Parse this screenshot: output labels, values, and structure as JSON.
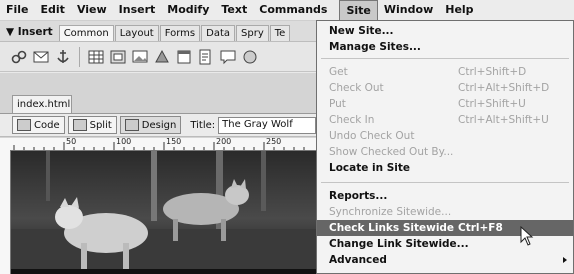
{
  "menubar": {
    "items": [
      "File",
      "Edit",
      "View",
      "Insert",
      "Modify",
      "Text",
      "Commands",
      "Site",
      "Window",
      "Help"
    ],
    "active": "Site"
  },
  "insert_bar": {
    "label": "▼ Insert",
    "tabs": [
      "Common",
      "Layout",
      "Forms",
      "Data",
      "Spry",
      "Te"
    ],
    "active_tab": "Common"
  },
  "document": {
    "tab": "index.html",
    "code_label": "Code",
    "split_label": "Split",
    "design_label": "Design",
    "title_label": "Title:",
    "title_value": "The Gray Wolf",
    "ruler_labels": [
      "50",
      "100",
      "150",
      "200",
      "250"
    ]
  },
  "site_menu": {
    "items": [
      {
        "label": "New Site...",
        "shortcut": "",
        "state": "bold"
      },
      {
        "label": "Manage Sites...",
        "shortcut": "",
        "state": "bold"
      },
      {
        "label": "Get",
        "shortcut": "Ctrl+Shift+D",
        "state": "dim"
      },
      {
        "label": "Check Out",
        "shortcut": "Ctrl+Alt+Shift+D",
        "state": "dim"
      },
      {
        "label": "Put",
        "shortcut": "Ctrl+Shift+U",
        "state": "dim"
      },
      {
        "label": "Check In",
        "shortcut": "Ctrl+Alt+Shift+U",
        "state": "dim"
      },
      {
        "label": "Undo Check Out",
        "shortcut": "",
        "state": "dim"
      },
      {
        "label": "Show Checked Out By...",
        "shortcut": "",
        "state": "dim"
      },
      {
        "label": "Locate in Site",
        "shortcut": "",
        "state": "bold"
      },
      {
        "label": "Reports...",
        "shortcut": "",
        "state": "bold"
      },
      {
        "label": "Synchronize Sitewide...",
        "shortcut": "",
        "state": "dim"
      },
      {
        "label": "Check Links Sitewide",
        "shortcut": "Ctrl+F8",
        "state": "highlighted"
      },
      {
        "label": "Change Link Sitewide...",
        "shortcut": "",
        "state": "bold"
      },
      {
        "label": "Advanced",
        "shortcut": "",
        "state": "bold",
        "submenu": true
      }
    ]
  },
  "icons": [
    "hyperlink-icon",
    "email-link-icon",
    "named-anchor-icon",
    "table-icon",
    "div-icon",
    "image-icon",
    "media-icon",
    "date-icon",
    "server-side-include-icon",
    "comment-icon",
    "head-icon"
  ],
  "colors": {
    "highlight": "#666666",
    "menu_bg": "#f3f3f3",
    "disabled_text": "#a3a3a3"
  }
}
